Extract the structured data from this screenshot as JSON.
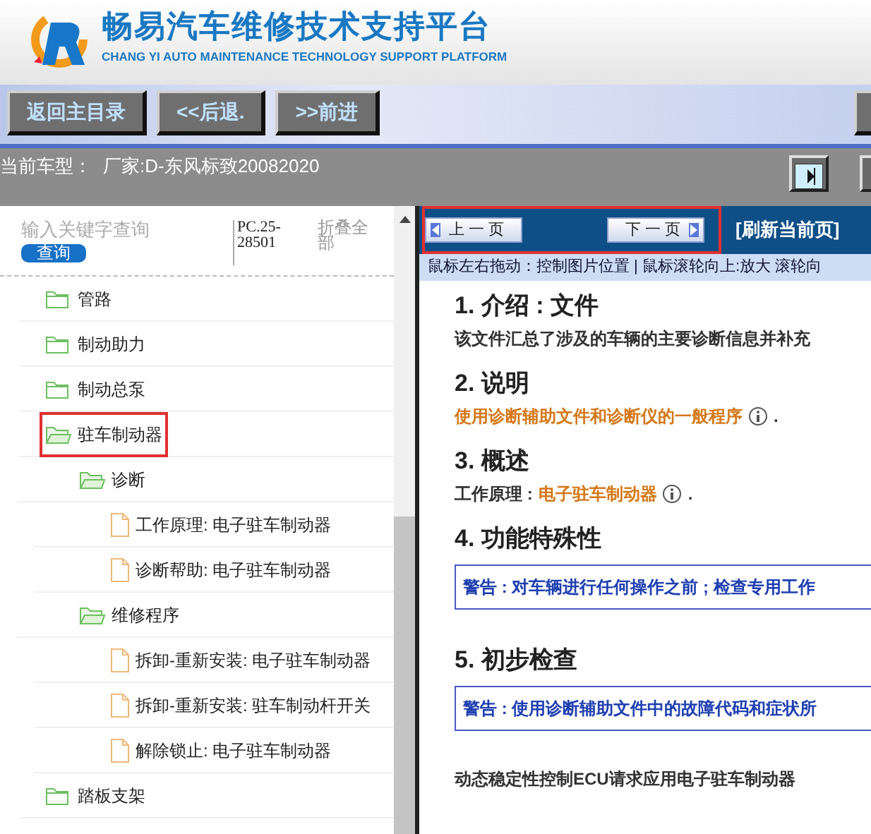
{
  "header": {
    "title": "畅易汽车维修技术支持平台",
    "subtitle": "CHANG YI AUTO MAINTENANCE TECHNOLOGY SUPPORT PLATFORM"
  },
  "toolbar": {
    "buttons": [
      "返回主目录",
      "<<后退.",
      ">>前进"
    ]
  },
  "vehicle_bar": {
    "label": "当前车型：",
    "value": "厂家:D-东风标致20082020"
  },
  "sidebar": {
    "search": {
      "placeholder": "输入关键字查询",
      "button": "查询"
    },
    "code": "PC.25-28501",
    "collapse_all": "折叠全部",
    "tree": [
      {
        "label": "管路",
        "kind": "folder",
        "expanded": false,
        "selected": false
      },
      {
        "label": "制动助力",
        "kind": "folder",
        "expanded": false,
        "selected": false
      },
      {
        "label": "制动总泵",
        "kind": "folder",
        "expanded": false,
        "selected": false
      },
      {
        "label": "驻车制动器",
        "kind": "folder",
        "expanded": true,
        "selected": true,
        "children": [
          {
            "label": "诊断",
            "kind": "folder",
            "expanded": true,
            "selected": false,
            "children": [
              {
                "label": "工作原理: 电子驻车制动器",
                "kind": "file",
                "selected": false
              },
              {
                "label": "诊断帮助: 电子驻车制动器",
                "kind": "file",
                "selected": false
              }
            ]
          },
          {
            "label": "维修程序",
            "kind": "folder",
            "expanded": true,
            "selected": false,
            "children": [
              {
                "label": "拆卸-重新安装: 电子驻车制动器",
                "kind": "file",
                "selected": false
              },
              {
                "label": "拆卸-重新安装: 驻车制动杆开关",
                "kind": "file",
                "selected": false
              },
              {
                "label": "解除锁止: 电子驻车制动器",
                "kind": "file",
                "selected": false
              }
            ]
          }
        ]
      },
      {
        "label": "踏板支架",
        "kind": "folder",
        "expanded": false,
        "selected": false
      }
    ]
  },
  "viewer": {
    "nav": {
      "highlighted": true,
      "prev": "上 一 页",
      "next": "下 一 页"
    },
    "refresh": "[刷新当前页]",
    "hint": "鼠标左右拖动：控制图片位置 | 鼠标滚轮向上:放大  滚轮向",
    "document": [
      {
        "kind": "heading",
        "text": "1. 介绍 : 文件"
      },
      {
        "kind": "para",
        "text": "该文件汇总了涉及的车辆的主要诊断信息并补充"
      },
      {
        "kind": "heading",
        "text": "2. 说明"
      },
      {
        "kind": "para",
        "link": "使用诊断辅助文件和诊断仪的一般程序",
        "info": true,
        "end": "."
      },
      {
        "kind": "heading",
        "text": "3. 概述"
      },
      {
        "kind": "para",
        "text": "工作原理 : ",
        "link": "电子驻车制动器",
        "info": true,
        "end": "."
      },
      {
        "kind": "heading",
        "text": "4. 功能特殊性"
      },
      {
        "kind": "warning",
        "text": "警告 : 对车辆进行任何操作之前 ; 检查专用工作"
      },
      {
        "kind": "heading",
        "text": "5. 初步检查"
      },
      {
        "kind": "warning",
        "text": "警告 : 使用诊断辅助文件中的故障代码和症状所"
      },
      {
        "kind": "para",
        "text": "动态稳定性控制ECU请求应用电子驻车制动器"
      }
    ]
  }
}
